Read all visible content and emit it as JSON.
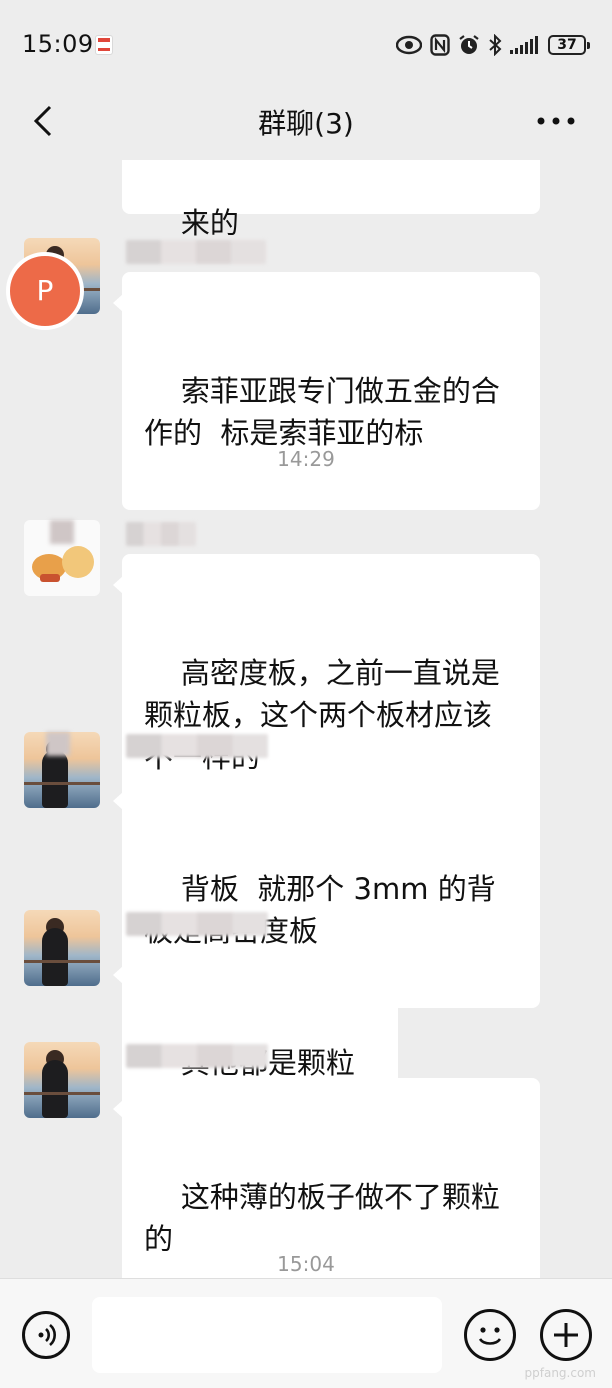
{
  "status_bar": {
    "time": "15:09",
    "battery": "37"
  },
  "header": {
    "title": "群聊(3)"
  },
  "messages": {
    "m0": "来的",
    "m1": "索菲亚跟专门做五金的合作的  标是索菲亚的标",
    "time1": "14:29",
    "m2": "高密度板，之前一直说是颗粒板，这个两个板材应该不一样的",
    "m3": "背板  就那个 3mm 的背板是高密度板",
    "m4": "其他都是颗粒板",
    "m5": "这种薄的板子做不了颗粒的",
    "time2": "15:04"
  },
  "float_avatar": {
    "letter": "P",
    "color": "#ed6a48"
  },
  "input": {
    "placeholder": ""
  },
  "watermark": "ppfang.com",
  "icons": [
    "back-icon",
    "more-icon",
    "eye-icon",
    "nfc-icon",
    "alarm-icon",
    "bluetooth-icon",
    "signal-icon",
    "battery-icon",
    "voice-icon",
    "emoji-icon",
    "plus-icon"
  ]
}
